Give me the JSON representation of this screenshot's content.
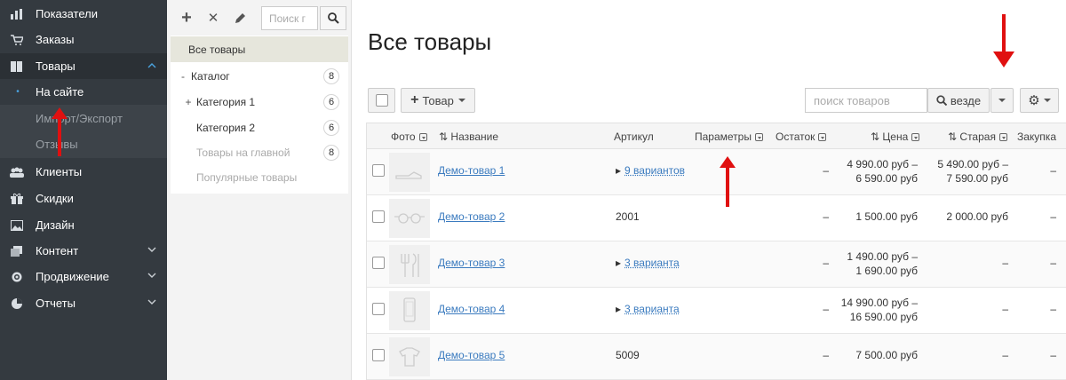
{
  "sidebar": {
    "items": [
      {
        "label": "Показатели",
        "icon": "bar-chart-icon"
      },
      {
        "label": "Заказы",
        "icon": "cart-icon"
      },
      {
        "label": "Товары",
        "icon": "book-icon"
      },
      {
        "label": "Клиенты",
        "icon": "users-icon"
      },
      {
        "label": "Скидки",
        "icon": "gift-icon"
      },
      {
        "label": "Дизайн",
        "icon": "image-icon"
      },
      {
        "label": "Контент",
        "icon": "pages-icon"
      },
      {
        "label": "Продвижение",
        "icon": "target-icon"
      },
      {
        "label": "Отчеты",
        "icon": "pie-chart-icon"
      }
    ],
    "subitems": [
      {
        "label": "На сайте"
      },
      {
        "label": "Импорт/Экспорт"
      },
      {
        "label": "Отзывы"
      }
    ],
    "expand_glyph": "^",
    "collapse_glyph": "v",
    "bullet": "•"
  },
  "catalog_panel": {
    "toolbar": {
      "add": "+",
      "delete": "✕",
      "search_placeholder": "Поиск г"
    },
    "rows": [
      {
        "label": "Все товары",
        "count": ""
      },
      {
        "prefix": "-",
        "label": "Каталог",
        "count": "8"
      },
      {
        "prefix": "+",
        "label": "Категория 1",
        "count": "6"
      },
      {
        "prefix": "",
        "label": "Категория 2",
        "count": "6"
      },
      {
        "prefix": "",
        "label": "Товары на главной",
        "count": "8"
      },
      {
        "prefix": "",
        "label": "Популярные товары",
        "count": ""
      }
    ]
  },
  "main": {
    "title": "Все товары",
    "add_product_label": "Товар",
    "add_product_plus": "+",
    "search_placeholder": "поиск товаров",
    "search_scope": "везде",
    "columns": {
      "photo": "Фото",
      "name": "Название",
      "sku": "Артикул",
      "params": "Параметры",
      "stock": "Остаток",
      "price": "Цена",
      "old_price": "Старая",
      "purchase": "Закупка"
    },
    "sort_glyph": "⇅",
    "expand_glyph": "▸",
    "products": [
      {
        "name": "Демо-товар 1",
        "sku": "",
        "variants": "9 вариантов",
        "stock": "–",
        "price1": "4 990.00 руб –",
        "price2": "6 590.00 руб",
        "old1": "5 490.00 руб –",
        "old2": "7 590.00 руб",
        "purchase": "–"
      },
      {
        "name": "Демо-товар 2",
        "sku": "2001",
        "variants": "",
        "stock": "–",
        "price1": "1 500.00 руб",
        "price2": "",
        "old1": "2 000.00 руб",
        "old2": "",
        "purchase": "–"
      },
      {
        "name": "Демо-товар 3",
        "sku": "",
        "variants": "3 варианта",
        "stock": "–",
        "price1": "1 490.00 руб –",
        "price2": "1 690.00 руб",
        "old1": "–",
        "old2": "",
        "purchase": "–"
      },
      {
        "name": "Демо-товар 4",
        "sku": "",
        "variants": "3 варианта",
        "stock": "–",
        "price1": "14 990.00 руб –",
        "price2": "16 590.00 руб",
        "old1": "–",
        "old2": "",
        "purchase": "–"
      },
      {
        "name": "Демо-товар 5",
        "sku": "5009",
        "variants": "",
        "stock": "–",
        "price1": "7 500.00 руб",
        "price2": "",
        "old1": "–",
        "old2": "",
        "purchase": "–"
      }
    ]
  },
  "colors": {
    "sidebar": "#343a40",
    "link": "#3b7bbf",
    "annotation_arrow": "#e01010"
  }
}
